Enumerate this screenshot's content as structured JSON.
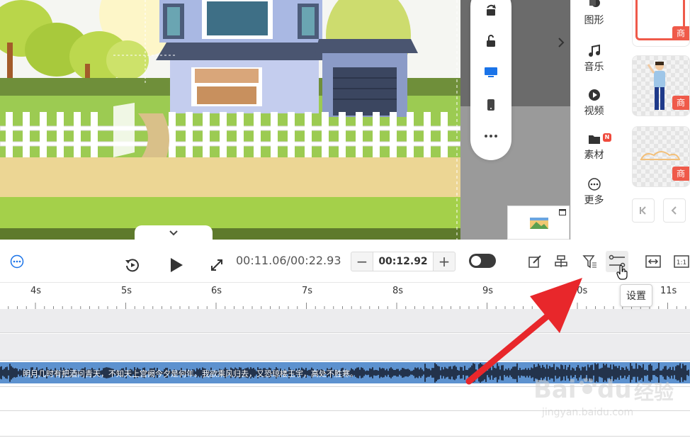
{
  "side_nav": {
    "items": [
      {
        "label": "图形",
        "icon": "shapes-icon"
      },
      {
        "label": "音乐",
        "icon": "music-icon"
      },
      {
        "label": "视频",
        "icon": "video-icon"
      },
      {
        "label": "素材",
        "icon": "folder-icon",
        "badge": "N"
      },
      {
        "label": "更多",
        "icon": "more-icon"
      }
    ]
  },
  "assets": {
    "tag": "商"
  },
  "controls": {
    "time_display": "00:11.06/00:22.93",
    "duration_value": "00:12.92",
    "minus_label": "−",
    "plus_label": "+"
  },
  "ruler": {
    "labels": [
      "4s",
      "5s",
      "6s",
      "7s",
      "8s",
      "9s",
      "10s",
      "11s"
    ]
  },
  "audio": {
    "lyrics": "明月几时有把酒问青天，不知天上宫阙今夕是何年。我欲乘风归去，又恐琼楼玉宇，高处不胜寒。"
  },
  "tooltip": {
    "label": "设置"
  },
  "watermark": {
    "brand": "Bai",
    "brand2": "du",
    "cn": "经验",
    "url": "jingyan.baidu.com"
  },
  "colors": {
    "accent_blue": "#1a73e8",
    "audio_track": "#5d92cf",
    "tag_red": "#ef5a4a",
    "arrow_red": "#e8272b"
  }
}
